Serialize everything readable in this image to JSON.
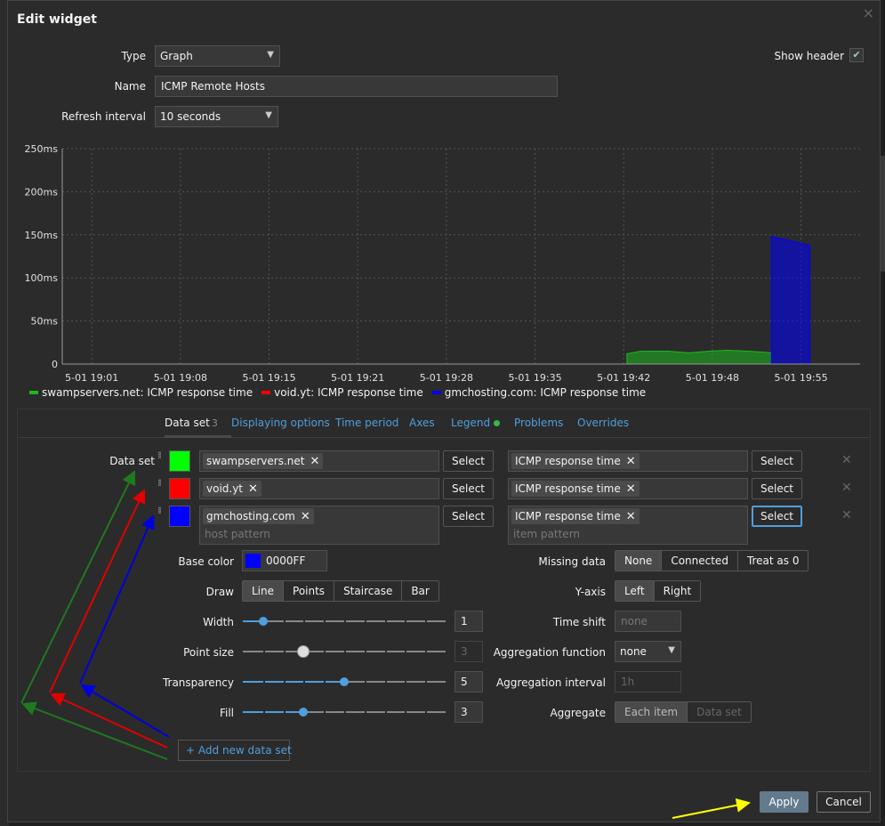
{
  "dialog": {
    "title": "Edit widget",
    "close_glyph": "×",
    "type_label": "Type",
    "type_value": "Graph",
    "show_header_label": "Show header",
    "show_header_checked": true,
    "name_label": "Name",
    "name_value": "ICMP Remote Hosts",
    "refresh_label": "Refresh interval",
    "refresh_value": "10 seconds"
  },
  "chart_data": {
    "type": "area",
    "y_ticks": [
      "250ms",
      "200ms",
      "150ms",
      "100ms",
      "50ms",
      "0"
    ],
    "ylim": [
      0,
      250
    ],
    "x_ticks": [
      "5-01 19:01",
      "5-01 19:08",
      "5-01 19:15",
      "5-01 19:21",
      "5-01 19:28",
      "5-01 19:35",
      "5-01 19:42",
      "5-01 19:48",
      "5-01 19:55"
    ],
    "grid": true,
    "series": [
      {
        "name": "swampservers.net: ICMP response time",
        "color": "#1eb81e",
        "points": [
          [
            19.11,
            0
          ],
          [
            19.11,
            12
          ],
          [
            19.6,
            15
          ],
          [
            20.5,
            15
          ],
          [
            21.2,
            13
          ],
          [
            21.9,
            15
          ],
          [
            22.5,
            16
          ],
          [
            23.2,
            15
          ],
          [
            24.0,
            13
          ],
          [
            24.0,
            0
          ]
        ]
      },
      {
        "name": "void.yt: ICMP response time",
        "color": "#ff0000",
        "points": []
      },
      {
        "name": "gmchosting.com: ICMP response time",
        "color": "#0000ff",
        "points": [
          [
            24.0,
            0
          ],
          [
            24.0,
            148
          ],
          [
            25.3,
            138
          ],
          [
            25.3,
            0
          ]
        ]
      }
    ],
    "legend_position": "bottom-left"
  },
  "tabs": [
    {
      "label": "Data set",
      "count": "3",
      "active": true
    },
    {
      "label": "Displaying options"
    },
    {
      "label": "Time period"
    },
    {
      "label": "Axes"
    },
    {
      "label": "Legend",
      "dot": true
    },
    {
      "label": "Problems"
    },
    {
      "label": "Overrides"
    }
  ],
  "dataset": {
    "label": "Data set",
    "rows": [
      {
        "color": "#00ff00",
        "host": "swampservers.net",
        "item": "ICMP response time"
      },
      {
        "color": "#ff0000",
        "host": "void.yt",
        "item": "ICMP response time"
      },
      {
        "color": "#0000ff",
        "host": "gmchosting.com",
        "item": "ICMP response time"
      }
    ],
    "select_label": "Select",
    "host_placeholder": "host pattern",
    "item_placeholder": "item pattern",
    "remove_glyph": "✕",
    "base_color_label": "Base color",
    "base_color_value": "0000FF",
    "base_color_hex": "#0000ff",
    "draw_label": "Draw",
    "draw_options": [
      "Line",
      "Points",
      "Staircase",
      "Bar"
    ],
    "draw_selected": "Line",
    "width_label": "Width",
    "width_value": "1",
    "point_size_label": "Point size",
    "point_size_value": "3",
    "transparency_label": "Transparency",
    "transparency_value": "5",
    "fill_label": "Fill",
    "fill_value": "3",
    "missing_label": "Missing data",
    "missing_options": [
      "None",
      "Connected",
      "Treat as 0"
    ],
    "missing_selected": "None",
    "yaxis_label": "Y-axis",
    "yaxis_options": [
      "Left",
      "Right"
    ],
    "yaxis_selected": "Left",
    "timeshift_label": "Time shift",
    "timeshift_placeholder": "none",
    "aggfunc_label": "Aggregation function",
    "aggfunc_value": "none",
    "agginterval_label": "Aggregation interval",
    "agginterval_placeholder": "1h",
    "aggregate_label": "Aggregate",
    "aggregate_options": [
      "Each item",
      "Data set"
    ],
    "aggregate_selected": "Each item",
    "add_label": "Add new data set"
  },
  "footer": {
    "apply_label": "Apply",
    "cancel_label": "Cancel"
  },
  "annotation_colors": {
    "green": "#1f7a1f",
    "red": "#e00000",
    "blue": "#0000dd",
    "yellow": "#ffff00"
  }
}
